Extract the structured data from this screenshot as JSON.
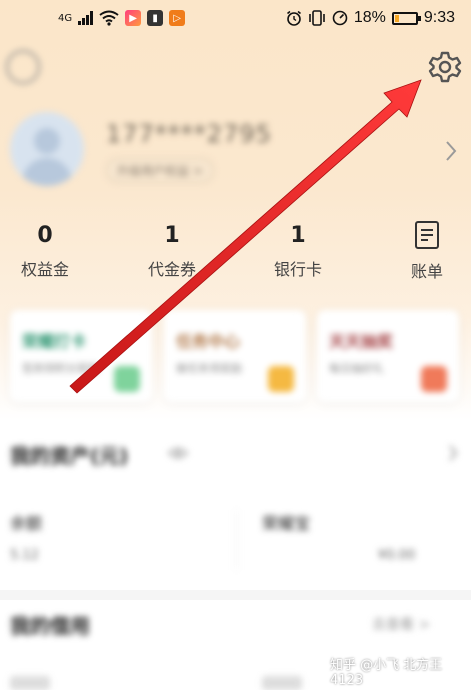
{
  "status_bar": {
    "network_label": "4G",
    "battery_percent_text": "18%",
    "time": "9:33",
    "battery_level": 0.18
  },
  "profile": {
    "phone_masked": "177****2795",
    "tag": "升级用户权益 >"
  },
  "stats": [
    {
      "value": "0",
      "label": "权益金"
    },
    {
      "value": "1",
      "label": "代金券"
    },
    {
      "value": "1",
      "label": "银行卡"
    }
  ],
  "bill": {
    "label": "账单",
    "icon": "bill-icon"
  },
  "cards": [
    {
      "title": "荣耀打卡",
      "subtitle": "签到领积分奖励",
      "accent": "#3a9c7a",
      "icon_color": "#7fd39c"
    },
    {
      "title": "任务中心",
      "subtitle": "做任务领奖励",
      "accent": "#b27a4b",
      "icon_color": "#f5b942"
    },
    {
      "title": "天天抽奖",
      "subtitle": "每日抽好礼",
      "accent": "#a6474a",
      "icon_color": "#f07a5a"
    }
  ],
  "assets": {
    "title": "我的资产(元)",
    "eye_icon": "eye-icon",
    "items": [
      {
        "label": "余额",
        "value": "5.12"
      },
      {
        "label": "荣耀宝",
        "value": "¥0.00"
      }
    ]
  },
  "credit": {
    "title": "我的借用",
    "action": "去查看 >"
  },
  "watermark": "知乎 @小飞 北方王4123",
  "colors": {
    "hero_top": "#fbe6c9",
    "arrow": "#e02020"
  }
}
